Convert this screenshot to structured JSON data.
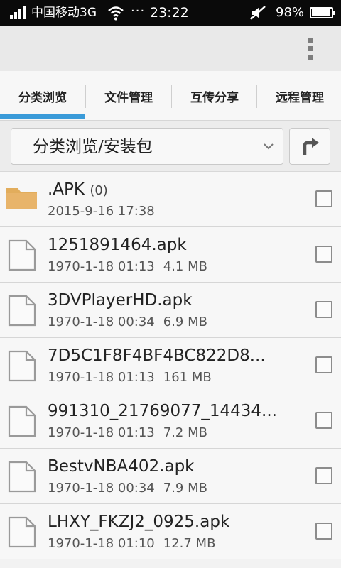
{
  "status_bar": {
    "carrier": "中国移动3G",
    "dots": "···",
    "time": "23:22",
    "battery": "98%",
    "battery_level": 0.98
  },
  "tabs": [
    {
      "label": "分类浏览",
      "active": true
    },
    {
      "label": "文件管理",
      "active": false
    },
    {
      "label": "互传分享",
      "active": false
    },
    {
      "label": "远程管理",
      "active": false
    }
  ],
  "path": {
    "current": "分类浏览/安装包"
  },
  "files": [
    {
      "name": ".APK",
      "count": "(0)",
      "date": "2015-9-16 17:38",
      "size": "",
      "type": "folder"
    },
    {
      "name": "1251891464.apk",
      "count": "",
      "date": "1970-1-18 01:13",
      "size": "4.1 MB",
      "type": "file"
    },
    {
      "name": "3DVPlayerHD.apk",
      "count": "",
      "date": "1970-1-18 00:34",
      "size": "6.9 MB",
      "type": "file"
    },
    {
      "name": "7D5C1F8F4BF4BC822D8...",
      "count": "",
      "date": "1970-1-18 01:13",
      "size": "161 MB",
      "type": "file"
    },
    {
      "name": "991310_21769077_14434...",
      "count": "",
      "date": "1970-1-18 01:13",
      "size": "7.2 MB",
      "type": "file"
    },
    {
      "name": "BestvNBA402.apk",
      "count": "",
      "date": "1970-1-18 00:34",
      "size": "7.9 MB",
      "type": "file"
    },
    {
      "name": "LHXY_FKZJ2_0925.apk",
      "count": "",
      "date": "1970-1-18 01:10",
      "size": "12.7 MB",
      "type": "file"
    }
  ],
  "colors": {
    "accent": "#3a9bd9",
    "folder": "#e2ad5c"
  }
}
